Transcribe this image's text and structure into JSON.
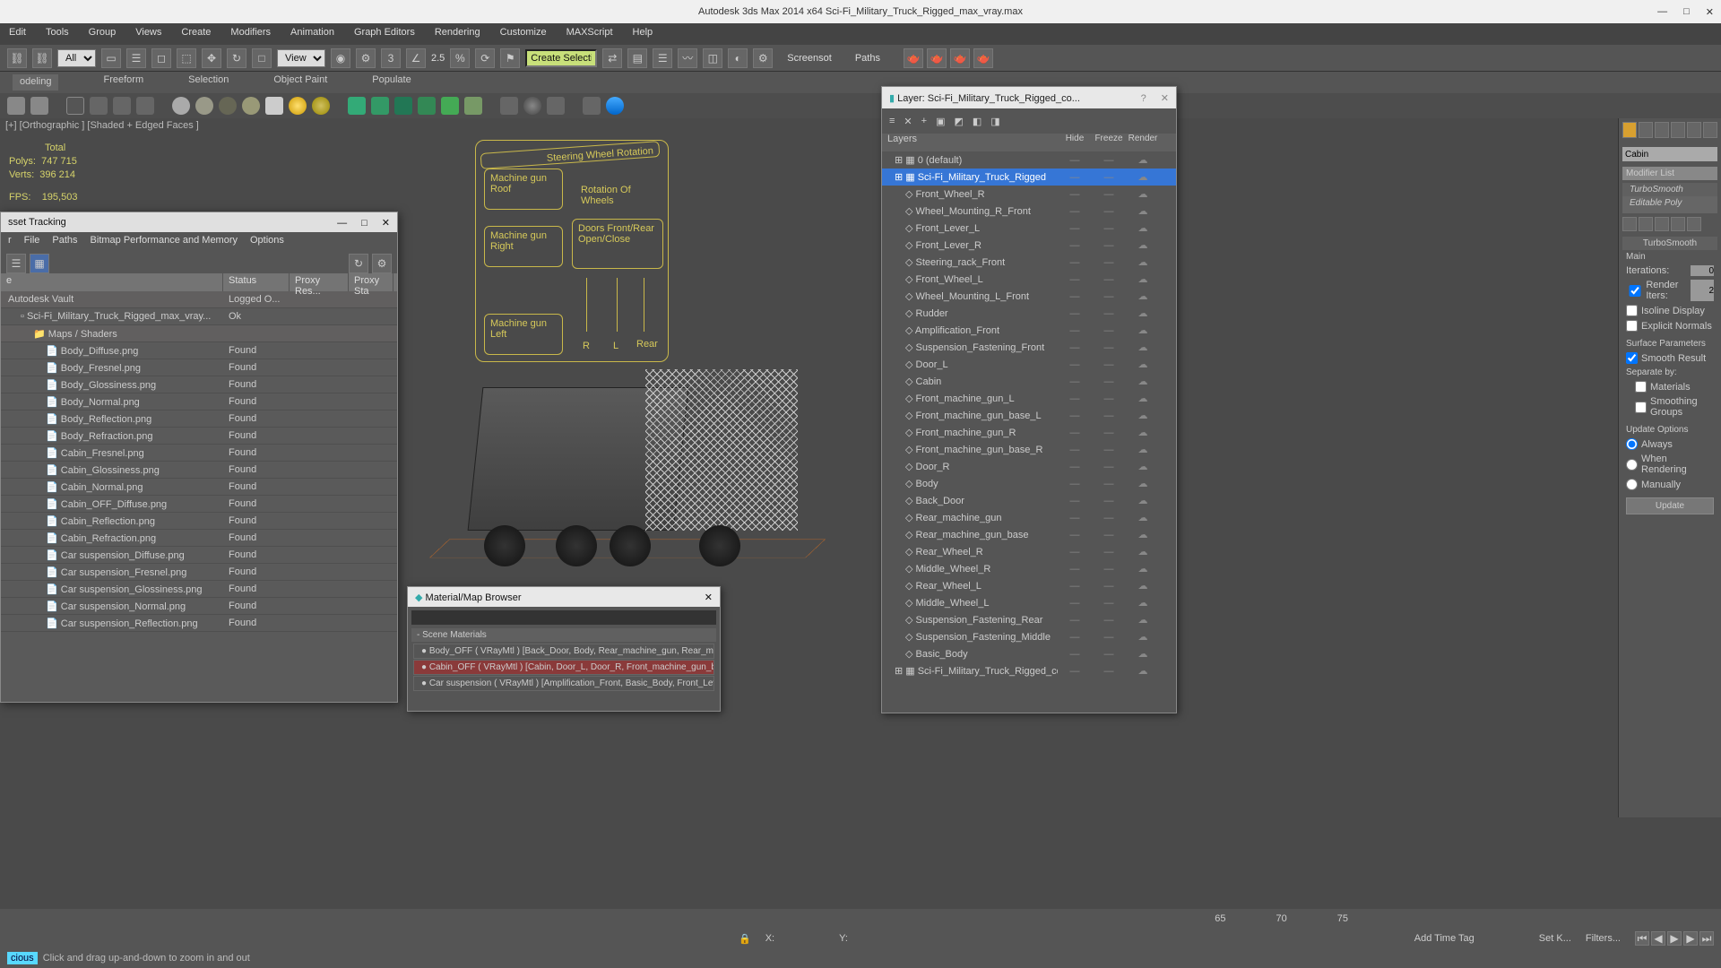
{
  "app": {
    "title": "Autodesk 3ds Max  2014 x64     Sci-Fi_Military_Truck_Rigged_max_vray.max"
  },
  "menu": [
    "Edit",
    "Tools",
    "Group",
    "Views",
    "Create",
    "Modifiers",
    "Animation",
    "Graph Editors",
    "Rendering",
    "Customize",
    "MAXScript",
    "Help"
  ],
  "toolbar": {
    "all_label": "All",
    "view_label": "View",
    "create_sel_label": "Create Selection S",
    "angle_label": "2.5",
    "screenshot": "Screensot",
    "paths": "Paths"
  },
  "ribbon": [
    "odeling",
    "Freeform",
    "Selection",
    "Object Paint",
    "Populate"
  ],
  "viewport": {
    "label": "[+] [Orthographic ] [Shaded + Edged Faces ]",
    "stats_total": "Total",
    "stats_polys_label": "Polys:",
    "stats_polys": "747 715",
    "stats_verts_label": "Verts:",
    "stats_verts": "396 214",
    "stats_fps_label": "FPS:",
    "stats_fps": "195,503"
  },
  "hud": {
    "steering": "Steering Wheel Rotation",
    "mg_roof": "Machine gun Roof",
    "rot_wheels": "Rotation Of Wheels",
    "mg_right": "Machine gun Right",
    "doors": "Doors Front/Rear Open/Close",
    "mg_left": "Machine gun Left",
    "r": "R",
    "l": "L",
    "rear": "Rear"
  },
  "asset": {
    "title": "sset Tracking",
    "menu": [
      "r",
      "File",
      "Paths",
      "Bitmap Performance and Memory",
      "Options"
    ],
    "cols": {
      "name": "e",
      "status": "Status",
      "proxy1": "Proxy Res...",
      "proxy2": "Proxy Sta"
    },
    "rows": [
      {
        "name": "Autodesk Vault",
        "status": "Logged O...",
        "h": true
      },
      {
        "name": "Sci-Fi_Military_Truck_Rigged_max_vray...",
        "status": "Ok",
        "lvl": 1
      },
      {
        "name": "Maps / Shaders",
        "status": "",
        "lvl": 2,
        "h": true
      },
      {
        "name": "Body_Diffuse.png",
        "status": "Found",
        "lvl": 3
      },
      {
        "name": "Body_Fresnel.png",
        "status": "Found",
        "lvl": 3
      },
      {
        "name": "Body_Glossiness.png",
        "status": "Found",
        "lvl": 3
      },
      {
        "name": "Body_Normal.png",
        "status": "Found",
        "lvl": 3
      },
      {
        "name": "Body_Reflection.png",
        "status": "Found",
        "lvl": 3
      },
      {
        "name": "Body_Refraction.png",
        "status": "Found",
        "lvl": 3
      },
      {
        "name": "Cabin_Fresnel.png",
        "status": "Found",
        "lvl": 3
      },
      {
        "name": "Cabin_Glossiness.png",
        "status": "Found",
        "lvl": 3
      },
      {
        "name": "Cabin_Normal.png",
        "status": "Found",
        "lvl": 3
      },
      {
        "name": "Cabin_OFF_Diffuse.png",
        "status": "Found",
        "lvl": 3
      },
      {
        "name": "Cabin_Reflection.png",
        "status": "Found",
        "lvl": 3
      },
      {
        "name": "Cabin_Refraction.png",
        "status": "Found",
        "lvl": 3
      },
      {
        "name": "Car suspension_Diffuse.png",
        "status": "Found",
        "lvl": 3
      },
      {
        "name": "Car suspension_Fresnel.png",
        "status": "Found",
        "lvl": 3
      },
      {
        "name": "Car suspension_Glossiness.png",
        "status": "Found",
        "lvl": 3
      },
      {
        "name": "Car suspension_Normal.png",
        "status": "Found",
        "lvl": 3
      },
      {
        "name": "Car suspension_Reflection.png",
        "status": "Found",
        "lvl": 3
      }
    ]
  },
  "material": {
    "title": "Material/Map Browser",
    "section": "- Scene Materials",
    "items": [
      "Body_OFF ( VRayMtl )  [Back_Door, Body, Rear_machine_gun, Rear_mac...",
      "Cabin_OFF ( VRayMtl )  [Cabin, Door_L, Door_R, Front_machine_gun_ba...",
      "Car suspension ( VRayMtl )  [Amplification_Front, Basic_Body, Front_Leve..."
    ]
  },
  "layers": {
    "title": "Layer: Sci-Fi_Military_Truck_Rigged_co...",
    "header": "Layers",
    "cols": {
      "hide": "Hide",
      "freeze": "Freeze",
      "render": "Render"
    },
    "items": [
      {
        "name": "0 (default)",
        "top": true
      },
      {
        "name": "Sci-Fi_Military_Truck_Rigged",
        "top": true,
        "sel": true
      },
      {
        "name": "Front_Wheel_R"
      },
      {
        "name": "Wheel_Mounting_R_Front"
      },
      {
        "name": "Front_Lever_L"
      },
      {
        "name": "Front_Lever_R"
      },
      {
        "name": "Steering_rack_Front"
      },
      {
        "name": "Front_Wheel_L"
      },
      {
        "name": "Wheel_Mounting_L_Front"
      },
      {
        "name": "Rudder"
      },
      {
        "name": "Amplification_Front"
      },
      {
        "name": "Suspension_Fastening_Front"
      },
      {
        "name": "Door_L"
      },
      {
        "name": "Cabin"
      },
      {
        "name": "Front_machine_gun_L"
      },
      {
        "name": "Front_machine_gun_base_L"
      },
      {
        "name": "Front_machine_gun_R"
      },
      {
        "name": "Front_machine_gun_base_R"
      },
      {
        "name": "Door_R"
      },
      {
        "name": "Body"
      },
      {
        "name": "Back_Door"
      },
      {
        "name": "Rear_machine_gun"
      },
      {
        "name": "Rear_machine_gun_base"
      },
      {
        "name": "Rear_Wheel_R"
      },
      {
        "name": "Middle_Wheel_R"
      },
      {
        "name": "Rear_Wheel_L"
      },
      {
        "name": "Middle_Wheel_L"
      },
      {
        "name": "Suspension_Fastening_Rear"
      },
      {
        "name": "Suspension_Fastening_Middle"
      },
      {
        "name": "Basic_Body"
      },
      {
        "name": "Sci-Fi_Military_Truck_Rigged_controllers",
        "top": true
      }
    ]
  },
  "cmd": {
    "name_field": "Cabin",
    "mod_list_label": "Modifier List",
    "stack": [
      "TurboSmooth",
      "Editable Poly"
    ],
    "roll_turbo": "TurboSmooth",
    "section_main": "Main",
    "iterations_label": "Iterations:",
    "iterations": "0",
    "render_iters_label": "Render Iters:",
    "render_iters": "2",
    "isoline": "Isoline Display",
    "explicit": "Explicit Normals",
    "surf_params": "Surface Parameters",
    "smooth_result": "Smooth Result",
    "separate": "Separate by:",
    "sep_mat": "Materials",
    "sep_sg": "Smoothing Groups",
    "update_opts": "Update Options",
    "always": "Always",
    "when_render": "When Rendering",
    "manually": "Manually",
    "update_btn": "Update"
  },
  "timeline": {
    "ticks": [
      "65",
      "70",
      "75"
    ]
  },
  "status": {
    "x": "X:",
    "y": "Y:",
    "add_tag": "Add Time Tag",
    "setk": "Set K...",
    "filters": "Filters..."
  },
  "prompt": {
    "max": "cious",
    "hint": "Click and drag up-and-down to zoom in and out"
  }
}
